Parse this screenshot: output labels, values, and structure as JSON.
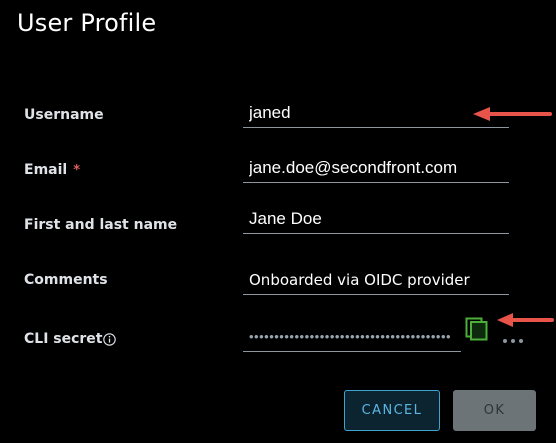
{
  "dialog": {
    "title": "User Profile"
  },
  "form": {
    "username": {
      "label": "Username",
      "value": "janed"
    },
    "email": {
      "label": "Email",
      "required_marker": "*",
      "value": "jane.doe@secondfront.com"
    },
    "name": {
      "label": "First and last name",
      "value": "Jane Doe"
    },
    "comments": {
      "label": "Comments",
      "value": "Onboarded via OIDC provider"
    },
    "cli_secret": {
      "label": "CLI secret",
      "masked_value": "••••••••••••••••••••••••••••••••••••••••"
    }
  },
  "icons": {
    "info": "info-icon",
    "copy": "copy-icon",
    "more": "ellipsis-icon",
    "arrow": "arrow-left-icon"
  },
  "buttons": {
    "cancel": "CANCEL",
    "ok": "OK"
  },
  "colors": {
    "background": "#000000",
    "arrow": "#e8544a",
    "copy_icon": "#4caf3a",
    "primary_accent": "#3fa3d0",
    "required": "#e0605c"
  }
}
